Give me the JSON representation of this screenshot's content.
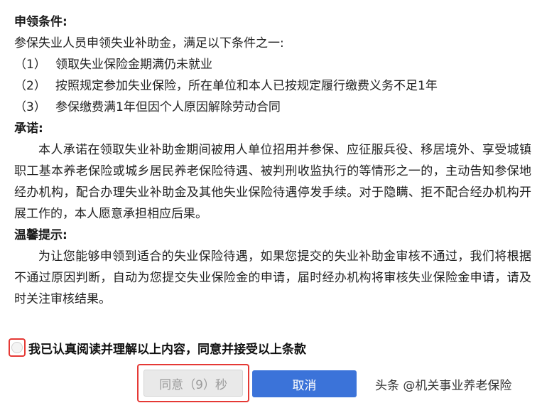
{
  "conditions": {
    "heading": "申领条件:",
    "intro": "参保失业人员申领失业补助金，满足以下条件之一:",
    "items": [
      {
        "num": "（1）",
        "text": "领取失业保险金期满仍未就业"
      },
      {
        "num": "（2）",
        "text": "按照规定参加失业保险，所在单位和本人已按规定履行缴费义务不足1年"
      },
      {
        "num": "（3）",
        "text": "参保缴费满1年但因个人原因解除劳动合同"
      }
    ]
  },
  "promise": {
    "heading": "承诺:",
    "body": "本人承诺在领取失业补助金期间被用人单位招用并参保、应征服兵役、移居境外、享受城镇职工基本养老保险或城乡居民养老保险待遇、被判刑收监执行的等情形之一的，主动告知参保地经办机构，配合办理失业补助金及其他失业保险待遇停发手续。对于隐瞒、拒不配合经办机构开展工作的，本人愿意承担相应后果。"
  },
  "tips": {
    "heading": "温馨提示:",
    "body": "为让您能够申领到适合的失业保险待遇，如果您提交的失业补助金审核不通过，我们将根据不通过原因判断，自动为您提交失业保险金的申请，届时经办机构将审核失业保险金申请，请及时关注审核结果。"
  },
  "agreement": {
    "label": "我已认真阅读并理解以上内容，同意并接受以上条款",
    "checked": false
  },
  "buttons": {
    "confirm_label": "同意（9）秒",
    "cancel_label": "取消"
  },
  "watermark": "头条 @机关事业养老保险",
  "colors": {
    "highlight": "#e53935",
    "cancel_bg": "#3b73d9",
    "confirm_bg_disabled": "#e9e9e9"
  }
}
